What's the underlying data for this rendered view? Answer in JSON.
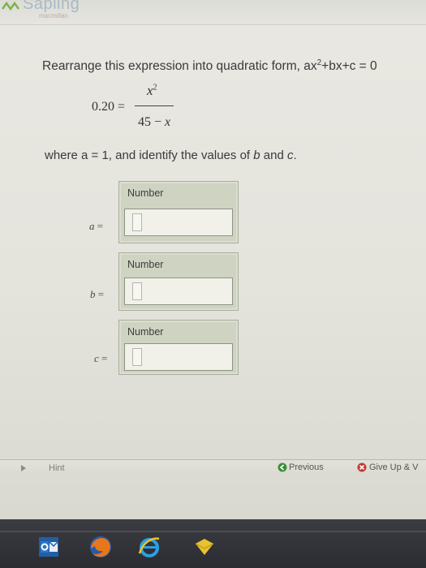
{
  "header": {
    "logo_text": "Sapling",
    "logo_sub": "macmillan"
  },
  "question": {
    "prompt": "Rearrange this expression into quadratic form, ax",
    "prompt_exp": "2",
    "prompt_tail": "+bx+c = 0",
    "eq_lhs": "0.20 =",
    "eq_num_var": "x",
    "eq_num_exp": "2",
    "eq_den": "45 − ",
    "eq_den_var": "x",
    "where_pre": "where a = 1, and identify the values of ",
    "where_b": "b",
    "where_and": " and ",
    "where_c": "c",
    "where_end": "."
  },
  "fields": [
    {
      "var": "a",
      "eq": " =",
      "label": "Number",
      "value": ""
    },
    {
      "var": "b",
      "eq": " =",
      "label": "Number",
      "value": ""
    },
    {
      "var": "c",
      "eq": " =",
      "label": "Number",
      "value": ""
    }
  ],
  "footer": {
    "hint": "Hint",
    "previous": "Previous",
    "give_up": "Give Up & V"
  },
  "taskbar": {
    "icons": [
      "outlook-icon",
      "firefox-icon",
      "internet-explorer-icon",
      "app-icon"
    ]
  },
  "colors": {
    "field_bg": "#cfd3c2",
    "input_bg": "#f1f1ea",
    "prev_icon": "#3a8f3a",
    "give_icon": "#c23a2e"
  }
}
